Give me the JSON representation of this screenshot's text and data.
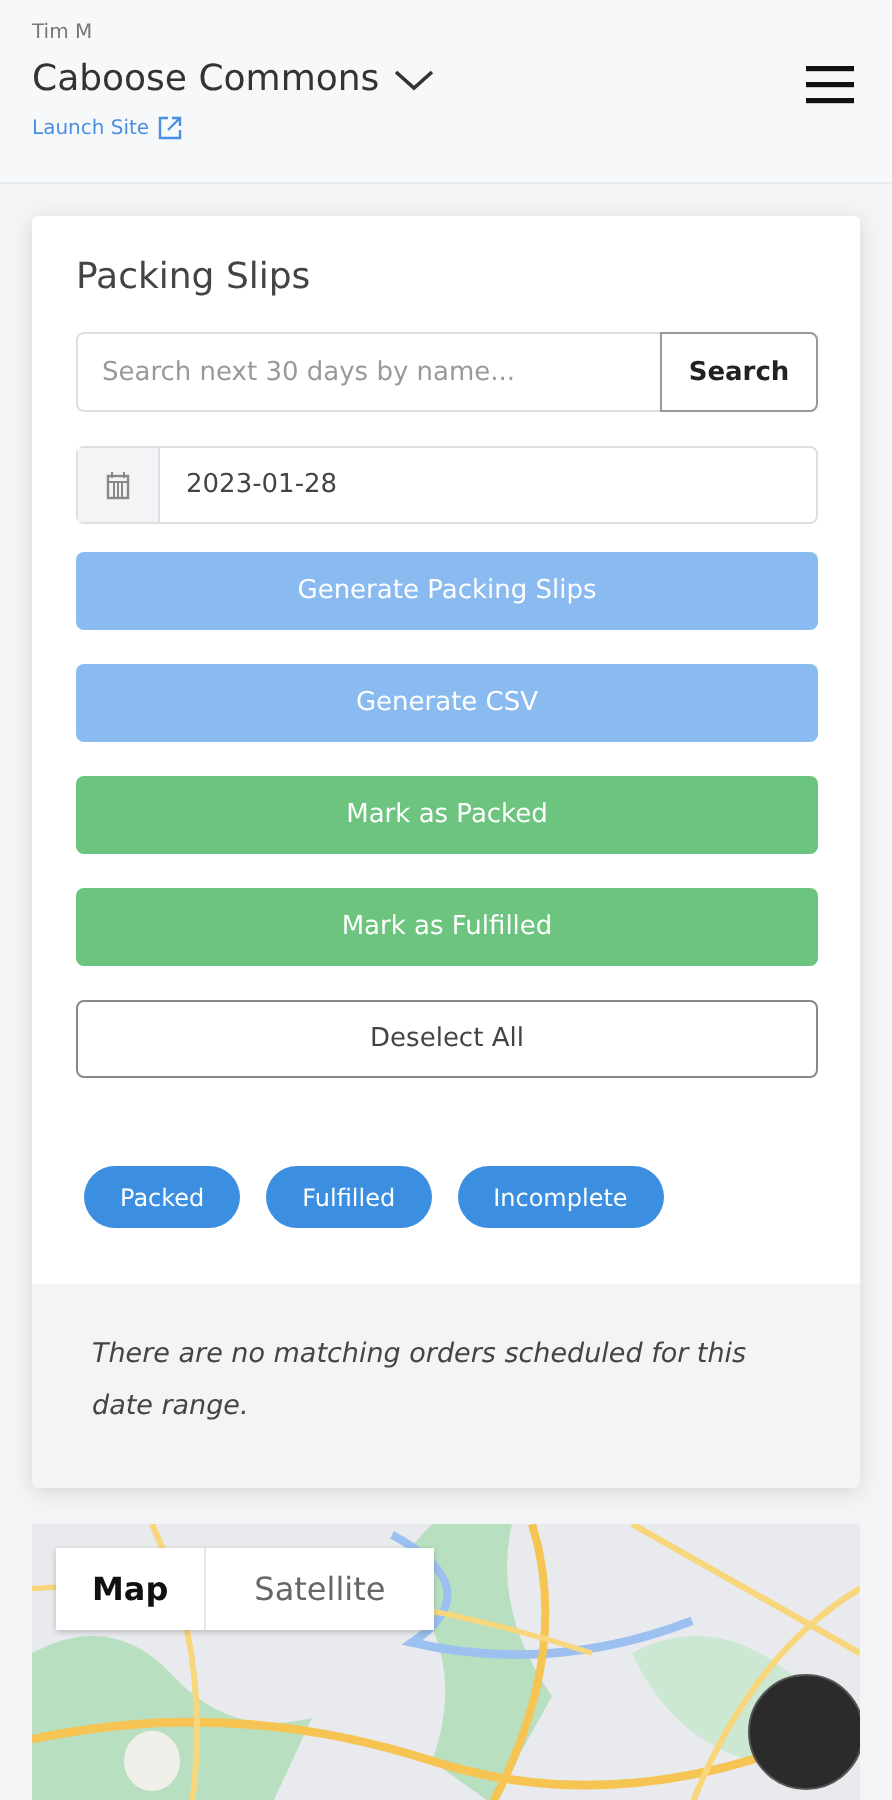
{
  "header": {
    "user": "Tim M",
    "site": "Caboose Commons",
    "link": "Launch Site"
  },
  "card": {
    "title": "Packing Slips",
    "search": {
      "placeholder": "Search next 30 days by name...",
      "button": "Search"
    },
    "date": {
      "value": "2023-01-28"
    },
    "buttons": [
      {
        "label": "Generate Packing Slips",
        "kind": "primary",
        "disabled": true
      },
      {
        "label": "Generate CSV",
        "kind": "primary",
        "disabled": true
      },
      {
        "label": "Mark as Packed",
        "kind": "success",
        "disabled": false
      },
      {
        "label": "Mark as Fulfilled",
        "kind": "success",
        "disabled": false
      },
      {
        "label": "Deselect All",
        "kind": "outline",
        "disabled": false
      }
    ],
    "filters": [
      {
        "label": "Packed"
      },
      {
        "label": "Fulfilled"
      },
      {
        "label": "Incomplete"
      }
    ],
    "empty_message": "There are no matching orders scheduled for this date range."
  },
  "map": {
    "types": [
      {
        "label": "Map",
        "selected": true
      },
      {
        "label": "Satellite",
        "selected": false
      }
    ]
  }
}
